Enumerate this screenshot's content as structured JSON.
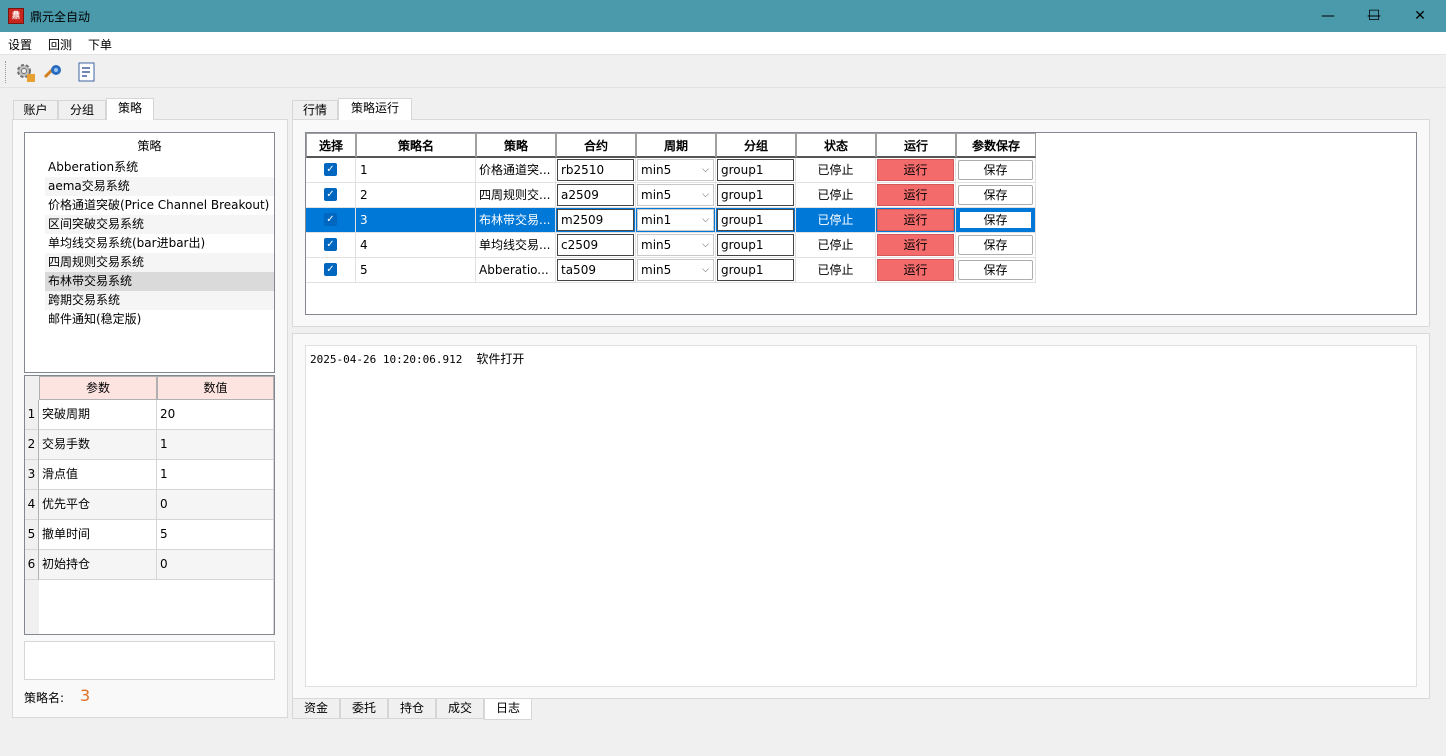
{
  "app": {
    "icon_text": "鼎",
    "title": "鼎元全自动"
  },
  "window_controls": {
    "minimize": "—",
    "maximize": "☐",
    "close": "✕"
  },
  "menu": [
    "设置",
    "回测",
    "下单"
  ],
  "toolbar": {
    "icons": [
      "gear-icon",
      "login-icon",
      "chart-icon"
    ]
  },
  "left_tabs": [
    "账户",
    "分组",
    "策略"
  ],
  "strategy_list": {
    "header": "策略",
    "items": [
      "Abberation系统",
      "aema交易系统",
      "价格通道突破(Price Channel Breakout)",
      "区间突破交易系统",
      "单均线交易系统(bar进bar出)",
      "四周规则交易系统",
      "布林带交易系统",
      "跨期交易系统",
      "邮件通知(稳定版)"
    ],
    "selected_index": 6
  },
  "params": {
    "headers": [
      "参数",
      "数值"
    ],
    "rows": [
      {
        "num": "1",
        "name": "突破周期",
        "value": "20"
      },
      {
        "num": "2",
        "name": "交易手数",
        "value": "1"
      },
      {
        "num": "3",
        "name": "滑点值",
        "value": "1"
      },
      {
        "num": "4",
        "name": "优先平仓",
        "value": "0"
      },
      {
        "num": "5",
        "name": "撤单时间",
        "value": "5"
      },
      {
        "num": "6",
        "name": "初始持仓",
        "value": "0"
      }
    ]
  },
  "strategy_name": {
    "label": "策略名:",
    "value": "3"
  },
  "right_tabs": [
    "行情",
    "策略运行"
  ],
  "grid": {
    "headers": [
      "选择",
      "策略名",
      "策略",
      "合约",
      "周期",
      "分组",
      "状态",
      "运行",
      "参数保存"
    ],
    "rows": [
      {
        "checked": "✓",
        "name": "1",
        "strategy": "价格通道突...",
        "contract": "rb2510",
        "period": "min5",
        "group": "group1",
        "status": "已停止",
        "run": "运行",
        "save": "保存"
      },
      {
        "checked": "✓",
        "name": "2",
        "strategy": "四周规则交...",
        "contract": "a2509",
        "period": "min5",
        "group": "group1",
        "status": "已停止",
        "run": "运行",
        "save": "保存"
      },
      {
        "checked": "✓",
        "name": "3",
        "strategy": "布林带交易...",
        "contract": "m2509",
        "period": "min1",
        "group": "group1",
        "status": "已停止",
        "run": "运行",
        "save": "保存"
      },
      {
        "checked": "✓",
        "name": "4",
        "strategy": "单均线交易...",
        "contract": "c2509",
        "period": "min5",
        "group": "group1",
        "status": "已停止",
        "run": "运行",
        "save": "保存"
      },
      {
        "checked": "✓",
        "name": "5",
        "strategy": "Abberatio...",
        "contract": "ta509",
        "period": "min5",
        "group": "group1",
        "status": "已停止",
        "run": "运行",
        "save": "保存"
      }
    ],
    "selected_row": 2
  },
  "log": [
    {
      "time": "2025-04-26 10:20:06.912",
      "msg": "软件打开"
    }
  ],
  "bottom_tabs": [
    "资金",
    "委托",
    "持仓",
    "成交",
    "日志"
  ],
  "colors": {
    "titlebar": "#4a9aab",
    "run_button": "#f36b6b",
    "selection": "#0078d7",
    "param_header": "#fde4e0",
    "strategy_name_value": "#e07020"
  }
}
